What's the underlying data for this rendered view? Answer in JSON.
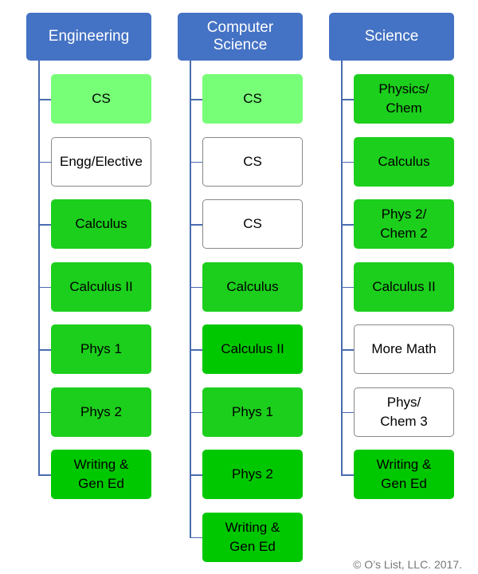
{
  "colors": {
    "header": "#4472C4",
    "light": "#77FF77",
    "medium": "#1CCF1C",
    "dark": "#00C800",
    "white": "#FFFFFF"
  },
  "columns": [
    {
      "title": "Engineering",
      "items": [
        {
          "label": "CS",
          "color": "light"
        },
        {
          "label": "Engg/Elective",
          "color": "white"
        },
        {
          "label": "Calculus",
          "color": "medium"
        },
        {
          "label": "Calculus II",
          "color": "medium"
        },
        {
          "label": "Phys 1",
          "color": "medium"
        },
        {
          "label": "Phys 2",
          "color": "medium"
        },
        {
          "label": "Writing &\nGen Ed",
          "color": "dark"
        }
      ]
    },
    {
      "title": "Computer\nScience",
      "items": [
        {
          "label": "CS",
          "color": "light"
        },
        {
          "label": "CS",
          "color": "white"
        },
        {
          "label": "CS",
          "color": "white"
        },
        {
          "label": "Calculus",
          "color": "medium"
        },
        {
          "label": "Calculus II",
          "color": "dark"
        },
        {
          "label": "Phys 1",
          "color": "medium"
        },
        {
          "label": "Phys 2",
          "color": "dark"
        },
        {
          "label": "Writing &\nGen Ed",
          "color": "dark"
        }
      ]
    },
    {
      "title": "Science",
      "items": [
        {
          "label": "Physics/\nChem",
          "color": "medium"
        },
        {
          "label": "Calculus",
          "color": "medium"
        },
        {
          "label": "Phys 2/\nChem 2",
          "color": "medium"
        },
        {
          "label": "Calculus II",
          "color": "medium"
        },
        {
          "label": "More Math",
          "color": "white"
        },
        {
          "label": "Phys/\nChem 3",
          "color": "white"
        },
        {
          "label": "Writing &\nGen Ed",
          "color": "dark"
        }
      ]
    }
  ],
  "copyright": "© O’s List, LLC. 2017."
}
